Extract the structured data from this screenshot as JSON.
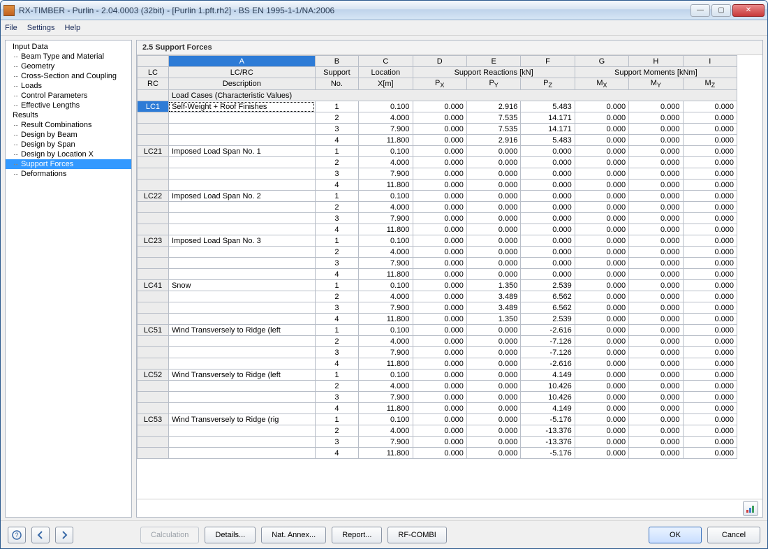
{
  "window": {
    "title": "RX-TIMBER - Purlin - 2.04.0003 (32bit) - [Purlin 1.pft.rh2] - BS EN 1995-1-1/NA:2006"
  },
  "menu": {
    "file": "File",
    "settings": "Settings",
    "help": "Help"
  },
  "sidebar": {
    "input_data": "Input Data",
    "beam_type": "Beam Type and Material",
    "geometry": "Geometry",
    "cross_section": "Cross-Section and Coupling",
    "loads": "Loads",
    "control_params": "Control Parameters",
    "eff_lengths": "Effective Lengths",
    "results": "Results",
    "result_comb": "Result Combinations",
    "design_beam": "Design by Beam",
    "design_span": "Design by Span",
    "design_locx": "Design by Location X",
    "support_forces": "Support Forces",
    "deformations": "Deformations"
  },
  "section_title": "2.5 Support Forces",
  "columns": {
    "letters": [
      "A",
      "B",
      "C",
      "D",
      "E",
      "F",
      "G",
      "H",
      "I"
    ],
    "lc_rc_top": "LC/RC",
    "lc_rc_bottom": "Description",
    "row_label_top": "LC",
    "row_label_bottom": "RC",
    "support": "Support",
    "support_sub": "No.",
    "location": "Location",
    "location_sub": "X[m]",
    "reactions_group": "Support Reactions [kN]",
    "px": "P",
    "px_sub": "X",
    "py": "P",
    "py_sub": "Y",
    "pz": "P",
    "pz_sub": "Z",
    "moments_group": "Support Moments [kNm]",
    "mx": "M",
    "mx_sub": "X",
    "my": "M",
    "my_sub": "Y",
    "mz": "M",
    "mz_sub": "Z"
  },
  "group_header": "Load Cases (Characteristic Values)",
  "blocks": [
    {
      "lc": "LC1",
      "desc": "Self-Weight + Roof Finishes",
      "rows": [
        {
          "sup": "1",
          "x": "0.100",
          "px": "0.000",
          "py": "2.916",
          "pz": "5.483",
          "mx": "0.000",
          "my": "0.000",
          "mz": "0.000"
        },
        {
          "sup": "2",
          "x": "4.000",
          "px": "0.000",
          "py": "7.535",
          "pz": "14.171",
          "mx": "0.000",
          "my": "0.000",
          "mz": "0.000"
        },
        {
          "sup": "3",
          "x": "7.900",
          "px": "0.000",
          "py": "7.535",
          "pz": "14.171",
          "mx": "0.000",
          "my": "0.000",
          "mz": "0.000"
        },
        {
          "sup": "4",
          "x": "11.800",
          "px": "0.000",
          "py": "2.916",
          "pz": "5.483",
          "mx": "0.000",
          "my": "0.000",
          "mz": "0.000"
        }
      ]
    },
    {
      "lc": "LC21",
      "desc": "Imposed Load Span No. 1",
      "rows": [
        {
          "sup": "1",
          "x": "0.100",
          "px": "0.000",
          "py": "0.000",
          "pz": "0.000",
          "mx": "0.000",
          "my": "0.000",
          "mz": "0.000"
        },
        {
          "sup": "2",
          "x": "4.000",
          "px": "0.000",
          "py": "0.000",
          "pz": "0.000",
          "mx": "0.000",
          "my": "0.000",
          "mz": "0.000"
        },
        {
          "sup": "3",
          "x": "7.900",
          "px": "0.000",
          "py": "0.000",
          "pz": "0.000",
          "mx": "0.000",
          "my": "0.000",
          "mz": "0.000"
        },
        {
          "sup": "4",
          "x": "11.800",
          "px": "0.000",
          "py": "0.000",
          "pz": "0.000",
          "mx": "0.000",
          "my": "0.000",
          "mz": "0.000"
        }
      ]
    },
    {
      "lc": "LC22",
      "desc": "Imposed Load Span No. 2",
      "rows": [
        {
          "sup": "1",
          "x": "0.100",
          "px": "0.000",
          "py": "0.000",
          "pz": "0.000",
          "mx": "0.000",
          "my": "0.000",
          "mz": "0.000"
        },
        {
          "sup": "2",
          "x": "4.000",
          "px": "0.000",
          "py": "0.000",
          "pz": "0.000",
          "mx": "0.000",
          "my": "0.000",
          "mz": "0.000"
        },
        {
          "sup": "3",
          "x": "7.900",
          "px": "0.000",
          "py": "0.000",
          "pz": "0.000",
          "mx": "0.000",
          "my": "0.000",
          "mz": "0.000"
        },
        {
          "sup": "4",
          "x": "11.800",
          "px": "0.000",
          "py": "0.000",
          "pz": "0.000",
          "mx": "0.000",
          "my": "0.000",
          "mz": "0.000"
        }
      ]
    },
    {
      "lc": "LC23",
      "desc": "Imposed Load Span No. 3",
      "rows": [
        {
          "sup": "1",
          "x": "0.100",
          "px": "0.000",
          "py": "0.000",
          "pz": "0.000",
          "mx": "0.000",
          "my": "0.000",
          "mz": "0.000"
        },
        {
          "sup": "2",
          "x": "4.000",
          "px": "0.000",
          "py": "0.000",
          "pz": "0.000",
          "mx": "0.000",
          "my": "0.000",
          "mz": "0.000"
        },
        {
          "sup": "3",
          "x": "7.900",
          "px": "0.000",
          "py": "0.000",
          "pz": "0.000",
          "mx": "0.000",
          "my": "0.000",
          "mz": "0.000"
        },
        {
          "sup": "4",
          "x": "11.800",
          "px": "0.000",
          "py": "0.000",
          "pz": "0.000",
          "mx": "0.000",
          "my": "0.000",
          "mz": "0.000"
        }
      ]
    },
    {
      "lc": "LC41",
      "desc": "Snow",
      "rows": [
        {
          "sup": "1",
          "x": "0.100",
          "px": "0.000",
          "py": "1.350",
          "pz": "2.539",
          "mx": "0.000",
          "my": "0.000",
          "mz": "0.000"
        },
        {
          "sup": "2",
          "x": "4.000",
          "px": "0.000",
          "py": "3.489",
          "pz": "6.562",
          "mx": "0.000",
          "my": "0.000",
          "mz": "0.000"
        },
        {
          "sup": "3",
          "x": "7.900",
          "px": "0.000",
          "py": "3.489",
          "pz": "6.562",
          "mx": "0.000",
          "my": "0.000",
          "mz": "0.000"
        },
        {
          "sup": "4",
          "x": "11.800",
          "px": "0.000",
          "py": "1.350",
          "pz": "2.539",
          "mx": "0.000",
          "my": "0.000",
          "mz": "0.000"
        }
      ]
    },
    {
      "lc": "LC51",
      "desc": "Wind Transversely to Ridge (left",
      "rows": [
        {
          "sup": "1",
          "x": "0.100",
          "px": "0.000",
          "py": "0.000",
          "pz": "-2.616",
          "mx": "0.000",
          "my": "0.000",
          "mz": "0.000"
        },
        {
          "sup": "2",
          "x": "4.000",
          "px": "0.000",
          "py": "0.000",
          "pz": "-7.126",
          "mx": "0.000",
          "my": "0.000",
          "mz": "0.000"
        },
        {
          "sup": "3",
          "x": "7.900",
          "px": "0.000",
          "py": "0.000",
          "pz": "-7.126",
          "mx": "0.000",
          "my": "0.000",
          "mz": "0.000"
        },
        {
          "sup": "4",
          "x": "11.800",
          "px": "0.000",
          "py": "0.000",
          "pz": "-2.616",
          "mx": "0.000",
          "my": "0.000",
          "mz": "0.000"
        }
      ]
    },
    {
      "lc": "LC52",
      "desc": "Wind Transversely to Ridge (left",
      "rows": [
        {
          "sup": "1",
          "x": "0.100",
          "px": "0.000",
          "py": "0.000",
          "pz": "4.149",
          "mx": "0.000",
          "my": "0.000",
          "mz": "0.000"
        },
        {
          "sup": "2",
          "x": "4.000",
          "px": "0.000",
          "py": "0.000",
          "pz": "10.426",
          "mx": "0.000",
          "my": "0.000",
          "mz": "0.000"
        },
        {
          "sup": "3",
          "x": "7.900",
          "px": "0.000",
          "py": "0.000",
          "pz": "10.426",
          "mx": "0.000",
          "my": "0.000",
          "mz": "0.000"
        },
        {
          "sup": "4",
          "x": "11.800",
          "px": "0.000",
          "py": "0.000",
          "pz": "4.149",
          "mx": "0.000",
          "my": "0.000",
          "mz": "0.000"
        }
      ]
    },
    {
      "lc": "LC53",
      "desc": "Wind Transversely to Ridge (rig",
      "rows": [
        {
          "sup": "1",
          "x": "0.100",
          "px": "0.000",
          "py": "0.000",
          "pz": "-5.176",
          "mx": "0.000",
          "my": "0.000",
          "mz": "0.000"
        },
        {
          "sup": "2",
          "x": "4.000",
          "px": "0.000",
          "py": "0.000",
          "pz": "-13.376",
          "mx": "0.000",
          "my": "0.000",
          "mz": "0.000"
        },
        {
          "sup": "3",
          "x": "7.900",
          "px": "0.000",
          "py": "0.000",
          "pz": "-13.376",
          "mx": "0.000",
          "my": "0.000",
          "mz": "0.000"
        },
        {
          "sup": "4",
          "x": "11.800",
          "px": "0.000",
          "py": "0.000",
          "pz": "-5.176",
          "mx": "0.000",
          "my": "0.000",
          "mz": "0.000"
        }
      ]
    }
  ],
  "buttons": {
    "calculation": "Calculation",
    "details": "Details...",
    "nat_annex": "Nat. Annex...",
    "report": "Report...",
    "rf_combi": "RF-COMBI",
    "ok": "OK",
    "cancel": "Cancel"
  }
}
